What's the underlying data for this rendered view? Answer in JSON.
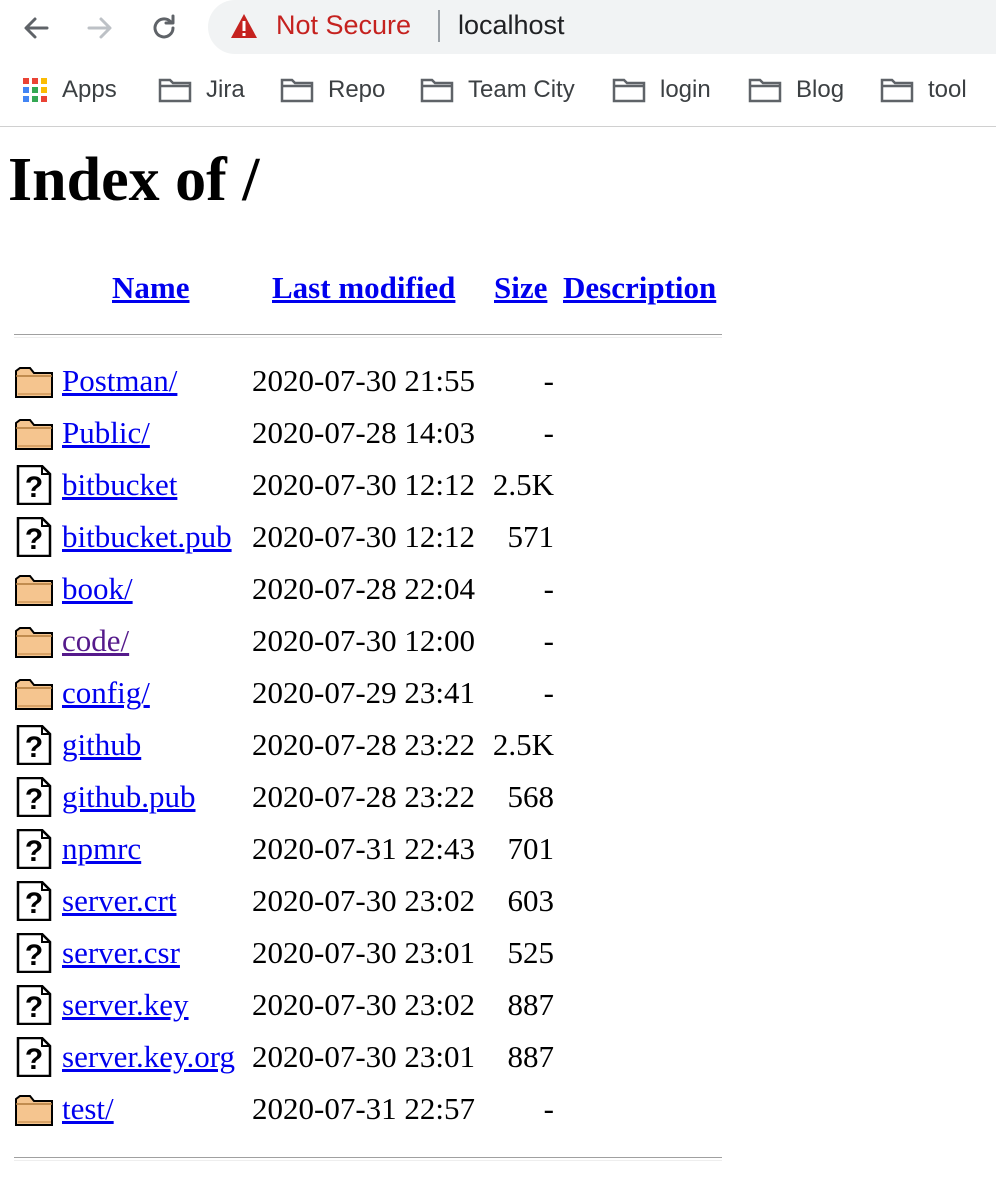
{
  "browser": {
    "security_label": "Not Secure",
    "url": "localhost",
    "bookmarks": [
      {
        "label": "Apps",
        "icon": "apps-grid-icon"
      },
      {
        "label": "Jira",
        "icon": "folder-icon"
      },
      {
        "label": "Repo",
        "icon": "folder-icon"
      },
      {
        "label": "Team City",
        "icon": "folder-icon"
      },
      {
        "label": "login",
        "icon": "folder-icon"
      },
      {
        "label": "Blog",
        "icon": "folder-icon"
      },
      {
        "label": "tool",
        "icon": "folder-icon"
      }
    ]
  },
  "page": {
    "title": "Index of /",
    "columns": {
      "name": "Name",
      "last_modified": "Last modified",
      "size": "Size",
      "description": "Description"
    },
    "entries": [
      {
        "name": "Postman/",
        "date": "2020-07-30 21:55",
        "size": "-",
        "type": "folder"
      },
      {
        "name": "Public/",
        "date": "2020-07-28 14:03",
        "size": "-",
        "type": "folder"
      },
      {
        "name": "bitbucket",
        "date": "2020-07-30 12:12",
        "size": "2.5K",
        "type": "file"
      },
      {
        "name": "bitbucket.pub",
        "date": "2020-07-30 12:12",
        "size": "571",
        "type": "file"
      },
      {
        "name": "book/",
        "date": "2020-07-28 22:04",
        "size": "-",
        "type": "folder"
      },
      {
        "name": "code/",
        "date": "2020-07-30 12:00",
        "size": "-",
        "type": "folder",
        "visited": true
      },
      {
        "name": "config/",
        "date": "2020-07-29 23:41",
        "size": "-",
        "type": "folder"
      },
      {
        "name": "github",
        "date": "2020-07-28 23:22",
        "size": "2.5K",
        "type": "file"
      },
      {
        "name": "github.pub",
        "date": "2020-07-28 23:22",
        "size": "568",
        "type": "file"
      },
      {
        "name": "npmrc",
        "date": "2020-07-31 22:43",
        "size": "701",
        "type": "file"
      },
      {
        "name": "server.crt",
        "date": "2020-07-30 23:02",
        "size": "603",
        "type": "file"
      },
      {
        "name": "server.csr",
        "date": "2020-07-30 23:01",
        "size": "525",
        "type": "file"
      },
      {
        "name": "server.key",
        "date": "2020-07-30 23:02",
        "size": "887",
        "type": "file"
      },
      {
        "name": "server.key.org",
        "date": "2020-07-30 23:01",
        "size": "887",
        "type": "file"
      },
      {
        "name": "test/",
        "date": "2020-07-31 22:57",
        "size": "-",
        "type": "folder"
      }
    ]
  },
  "colors": {
    "link": "#0000ee",
    "visited_link": "#551a8b",
    "warning": "#c5221f"
  }
}
